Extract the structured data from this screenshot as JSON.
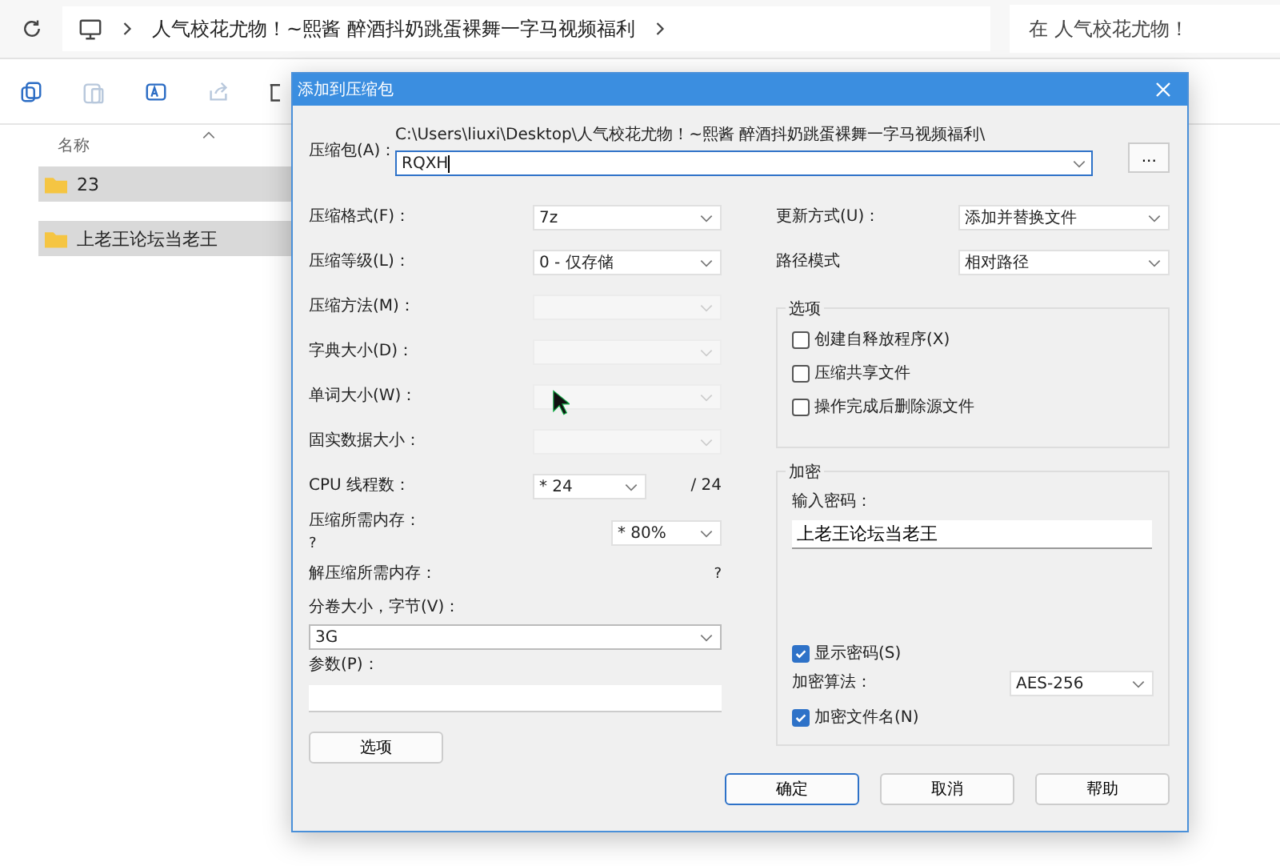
{
  "explorer": {
    "breadcrumb": [
      "人气校花尤物！~熙酱 醉酒抖奶跳蛋裸舞一字马视频福利"
    ],
    "search": {
      "placeholder": "在 人气校花尤物！"
    },
    "column_header": "名称",
    "files": [
      {
        "name": "23",
        "selected": true
      },
      {
        "name": "上老王论坛当老王",
        "selected": true
      }
    ]
  },
  "dialog": {
    "title": "添加到压缩包",
    "archive_label": "压缩包(A)：",
    "archive_path": "C:\\Users\\liuxi\\Desktop\\人气校花尤物！~熙酱 醉酒抖奶跳蛋裸舞一字马视频福利\\",
    "archive_name": "RQXH",
    "browse_button": "...",
    "left_rows": [
      {
        "kind": "combo",
        "label": "压缩格式(F)：",
        "value": "7z",
        "disabled": false
      },
      {
        "kind": "combo",
        "label": "压缩等级(L)：",
        "value": "0 - 仅存储",
        "disabled": false
      },
      {
        "kind": "combo",
        "label": "压缩方法(M)：",
        "disabled": true
      },
      {
        "kind": "combo",
        "label": "字典大小(D)：",
        "disabled": true
      },
      {
        "kind": "combo",
        "label": "单词大小(W)：",
        "disabled": true
      },
      {
        "kind": "combo",
        "label": "固实数据大小：",
        "disabled": true
      },
      {
        "kind": "threads",
        "label": "CPU 线程数：",
        "value": "* 24",
        "suffix": "/ 24"
      },
      {
        "kind": "memory",
        "label": "压缩所需内存：",
        "note": "?",
        "value": "* 80%"
      },
      {
        "kind": "info",
        "label": "解压缩所需内存：",
        "note": "?"
      },
      {
        "kind": "wide_combo",
        "label": "分卷大小，字节(V)：",
        "value": "3G"
      },
      {
        "kind": "wide_field",
        "label": "参数(P)："
      }
    ],
    "options_button": "选项",
    "right_rows": [
      {
        "label": "更新方式(U)：",
        "value": "添加并替换文件"
      },
      {
        "label": "路径模式",
        "value": "相对路径"
      }
    ],
    "options_group": {
      "title": "选项",
      "checkboxes": [
        {
          "label": "创建自释放程序(X)",
          "checked": false
        },
        {
          "label": "压缩共享文件",
          "checked": false
        },
        {
          "label": "操作完成后删除源文件",
          "checked": false
        }
      ]
    },
    "encryption": {
      "title": "加密",
      "password_label": "输入密码：",
      "password": "上老王论坛当老王",
      "show_password": {
        "label": "显示密码(S)",
        "checked": true
      },
      "method_label": "加密算法：",
      "method": "AES-256",
      "encrypt_names": {
        "label": "加密文件名(N)",
        "checked": true
      }
    },
    "buttons": [
      {
        "label": "确定",
        "default": true
      },
      {
        "label": "取消",
        "default": false
      },
      {
        "label": "帮助",
        "default": false
      }
    ]
  }
}
